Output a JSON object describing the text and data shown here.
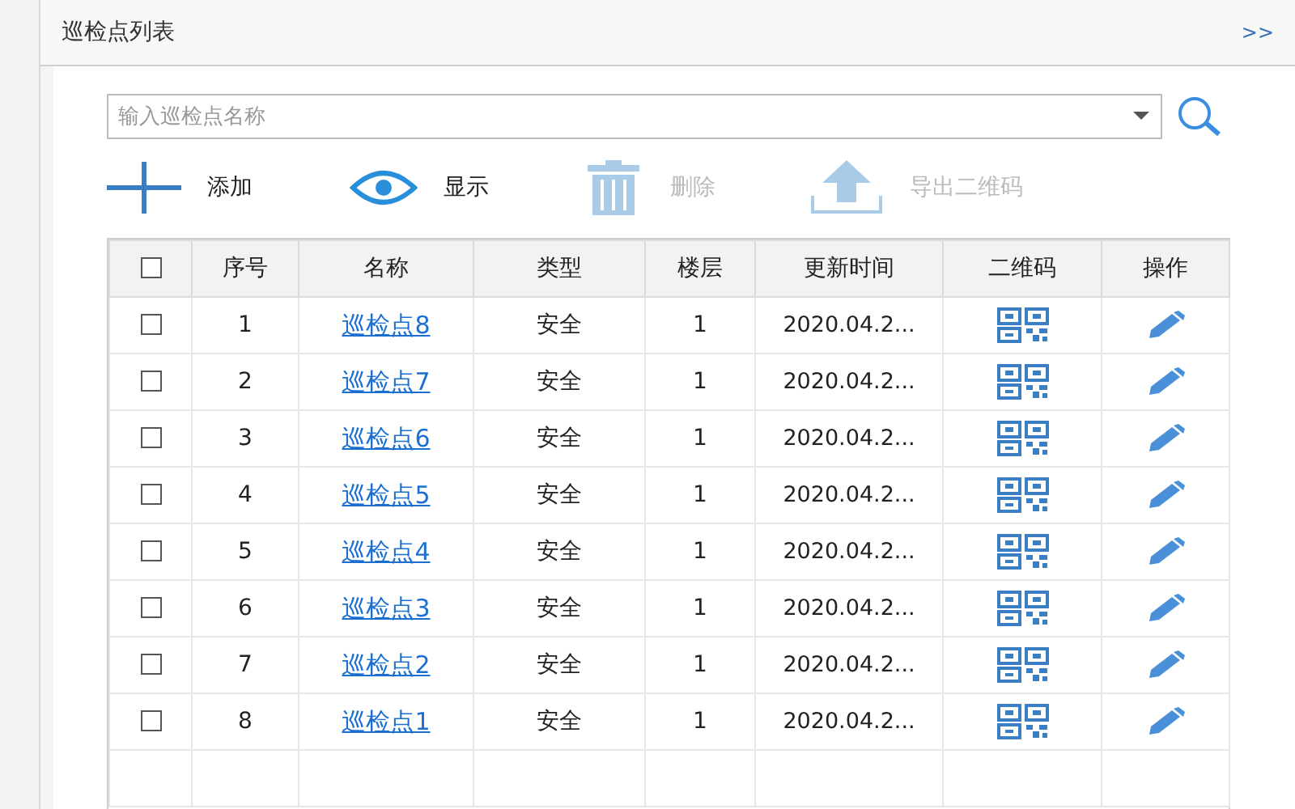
{
  "panel": {
    "title": "巡检点列表",
    "collapse": ">>"
  },
  "search": {
    "placeholder": "输入巡检点名称"
  },
  "toolbar": [
    {
      "kind": "add",
      "label": "添加",
      "disabled": false
    },
    {
      "kind": "show",
      "label": "显示",
      "disabled": false
    },
    {
      "kind": "delete",
      "label": "删除",
      "disabled": true
    },
    {
      "kind": "export",
      "label": "导出二维码",
      "disabled": true
    }
  ],
  "table": {
    "select_all_checked": false,
    "columns": [
      "序号",
      "名称",
      "类型",
      "楼层",
      "更新时间",
      "二维码",
      "操作"
    ],
    "rows": [
      {
        "checked": false,
        "no": "1",
        "name": "巡检点8",
        "type": "安全",
        "floor": "1",
        "updated": "2020.04.2..."
      },
      {
        "checked": false,
        "no": "2",
        "name": "巡检点7",
        "type": "安全",
        "floor": "1",
        "updated": "2020.04.2..."
      },
      {
        "checked": false,
        "no": "3",
        "name": "巡检点6",
        "type": "安全",
        "floor": "1",
        "updated": "2020.04.2..."
      },
      {
        "checked": false,
        "no": "4",
        "name": "巡检点5",
        "type": "安全",
        "floor": "1",
        "updated": "2020.04.2..."
      },
      {
        "checked": false,
        "no": "5",
        "name": "巡检点4",
        "type": "安全",
        "floor": "1",
        "updated": "2020.04.2..."
      },
      {
        "checked": false,
        "no": "6",
        "name": "巡检点3",
        "type": "安全",
        "floor": "1",
        "updated": "2020.04.2..."
      },
      {
        "checked": false,
        "no": "7",
        "name": "巡检点2",
        "type": "安全",
        "floor": "1",
        "updated": "2020.04.2..."
      },
      {
        "checked": false,
        "no": "8",
        "name": "巡检点1",
        "type": "安全",
        "floor": "1",
        "updated": "2020.04.2..."
      }
    ]
  }
}
